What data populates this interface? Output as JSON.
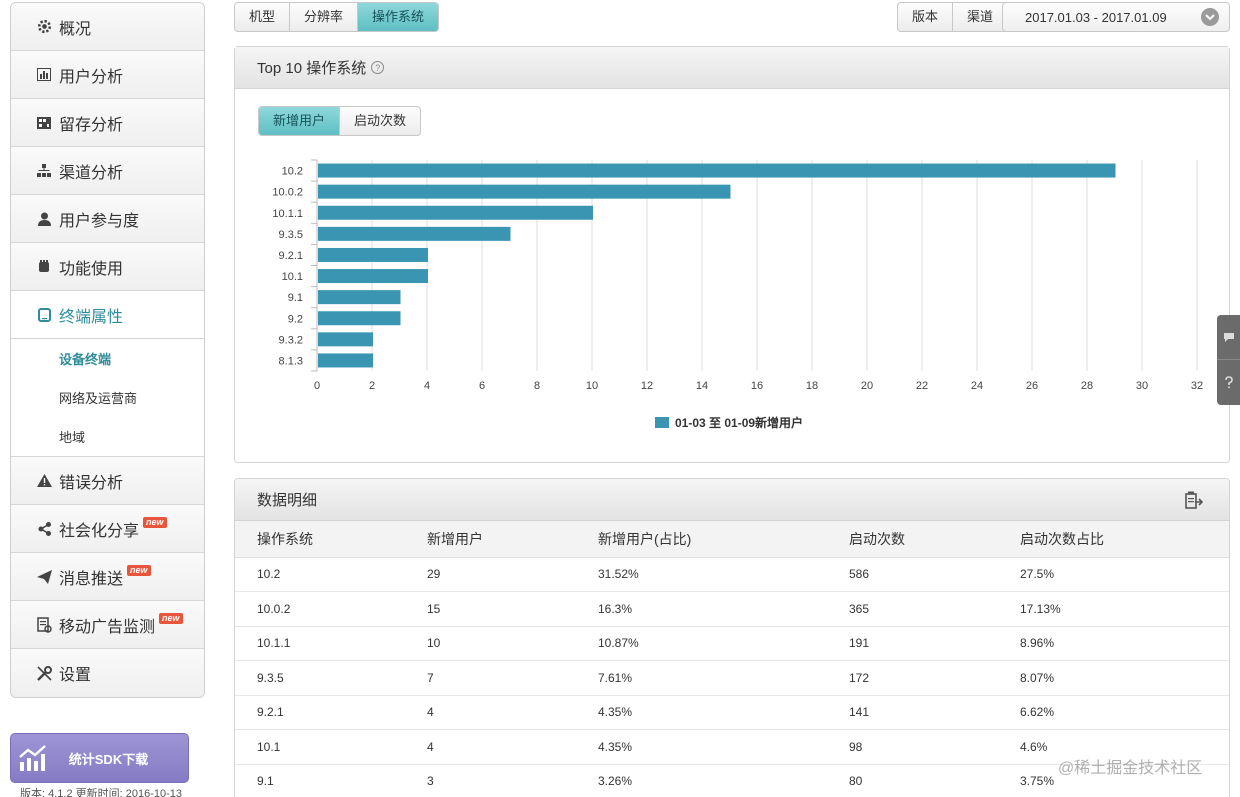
{
  "sidebar": {
    "items": [
      {
        "label": "概况",
        "icon": "gear-icon"
      },
      {
        "label": "用户分析",
        "icon": "bar-chart-icon"
      },
      {
        "label": "留存分析",
        "icon": "grid-icon"
      },
      {
        "label": "渠道分析",
        "icon": "hierarchy-icon"
      },
      {
        "label": "用户参与度",
        "icon": "person-icon"
      },
      {
        "label": "功能使用",
        "icon": "hand-icon"
      },
      {
        "label": "终端属性",
        "icon": "device-icon"
      }
    ],
    "subitems": [
      {
        "label": "设备终端"
      },
      {
        "label": "网络及运营商"
      },
      {
        "label": "地域"
      }
    ],
    "items_after": [
      {
        "label": "错误分析",
        "icon": "warning-icon"
      },
      {
        "label": "社会化分享",
        "icon": "share-icon",
        "badge": "new"
      },
      {
        "label": "消息推送",
        "icon": "send-icon",
        "badge": "new"
      },
      {
        "label": "移动广告监测",
        "icon": "ad-monitor-icon",
        "badge": "new"
      },
      {
        "label": "设置",
        "icon": "tools-icon"
      }
    ],
    "sdk_button": "统计SDK下载",
    "version": "版本: 4.1.2 更新时间: 2016-10-13"
  },
  "top_tabs": [
    "机型",
    "分辨率",
    "操作系统"
  ],
  "filter_tabs": [
    "版本",
    "渠道"
  ],
  "date_range": "2017.01.03 - 2017.01.09",
  "chart_panel": {
    "title": "Top 10 操作系统",
    "help": "?",
    "subtabs": [
      "新增用户",
      "启动次数"
    ]
  },
  "chart_data": {
    "type": "bar",
    "orientation": "horizontal",
    "categories": [
      "10.2",
      "10.0.2",
      "10.1.1",
      "9.3.5",
      "9.2.1",
      "10.1",
      "9.1",
      "9.2",
      "9.3.2",
      "8.1.3"
    ],
    "series": [
      {
        "name": "01-03 至 01-09新增用户",
        "values": [
          29,
          15,
          10,
          7,
          4,
          4,
          3,
          3,
          2,
          2
        ]
      }
    ],
    "xlim": [
      0,
      32
    ],
    "xticks": [
      0,
      2,
      4,
      6,
      8,
      10,
      12,
      14,
      16,
      18,
      20,
      22,
      24,
      26,
      28,
      30,
      32
    ],
    "grid": true,
    "legend": "bottom-center",
    "color": "#3a95b2"
  },
  "table_panel": {
    "title": "数据明细",
    "columns": [
      "操作系统",
      "新增用户",
      "新增用户(占比)",
      "启动次数",
      "启动次数占比"
    ],
    "rows": [
      [
        "10.2",
        "29",
        "31.52%",
        "586",
        "27.5%"
      ],
      [
        "10.0.2",
        "15",
        "16.3%",
        "365",
        "17.13%"
      ],
      [
        "10.1.1",
        "10",
        "10.87%",
        "191",
        "8.96%"
      ],
      [
        "9.3.5",
        "7",
        "7.61%",
        "172",
        "8.07%"
      ],
      [
        "9.2.1",
        "4",
        "4.35%",
        "141",
        "6.62%"
      ],
      [
        "10.1",
        "4",
        "4.35%",
        "98",
        "4.6%"
      ],
      [
        "9.1",
        "3",
        "3.26%",
        "80",
        "3.75%"
      ]
    ]
  },
  "watermark": "@稀土掘金技术社区",
  "colors": {
    "accent": "#2e8d9a",
    "bar": "#3a95b2",
    "badge": "#e8553d",
    "sdk": "#8f86cc"
  }
}
